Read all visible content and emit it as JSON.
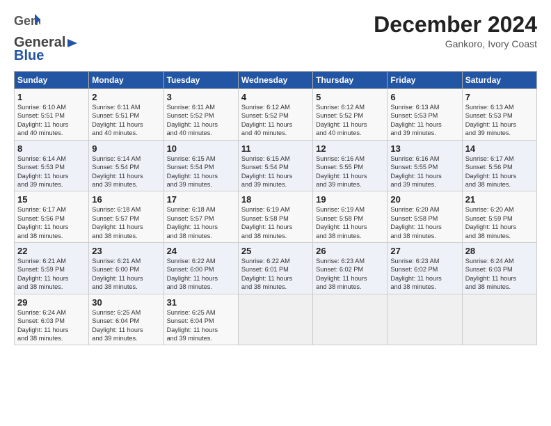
{
  "logo": {
    "part1": "General",
    "part2": "Blue"
  },
  "header": {
    "month": "December 2024",
    "location": "Gankoro, Ivory Coast"
  },
  "weekdays": [
    "Sunday",
    "Monday",
    "Tuesday",
    "Wednesday",
    "Thursday",
    "Friday",
    "Saturday"
  ],
  "weeks": [
    [
      {
        "day": "1",
        "info": "Sunrise: 6:10 AM\nSunset: 5:51 PM\nDaylight: 11 hours\nand 40 minutes."
      },
      {
        "day": "2",
        "info": "Sunrise: 6:11 AM\nSunset: 5:51 PM\nDaylight: 11 hours\nand 40 minutes."
      },
      {
        "day": "3",
        "info": "Sunrise: 6:11 AM\nSunset: 5:52 PM\nDaylight: 11 hours\nand 40 minutes."
      },
      {
        "day": "4",
        "info": "Sunrise: 6:12 AM\nSunset: 5:52 PM\nDaylight: 11 hours\nand 40 minutes."
      },
      {
        "day": "5",
        "info": "Sunrise: 6:12 AM\nSunset: 5:52 PM\nDaylight: 11 hours\nand 40 minutes."
      },
      {
        "day": "6",
        "info": "Sunrise: 6:13 AM\nSunset: 5:53 PM\nDaylight: 11 hours\nand 39 minutes."
      },
      {
        "day": "7",
        "info": "Sunrise: 6:13 AM\nSunset: 5:53 PM\nDaylight: 11 hours\nand 39 minutes."
      }
    ],
    [
      {
        "day": "8",
        "info": "Sunrise: 6:14 AM\nSunset: 5:53 PM\nDaylight: 11 hours\nand 39 minutes."
      },
      {
        "day": "9",
        "info": "Sunrise: 6:14 AM\nSunset: 5:54 PM\nDaylight: 11 hours\nand 39 minutes."
      },
      {
        "day": "10",
        "info": "Sunrise: 6:15 AM\nSunset: 5:54 PM\nDaylight: 11 hours\nand 39 minutes."
      },
      {
        "day": "11",
        "info": "Sunrise: 6:15 AM\nSunset: 5:54 PM\nDaylight: 11 hours\nand 39 minutes."
      },
      {
        "day": "12",
        "info": "Sunrise: 6:16 AM\nSunset: 5:55 PM\nDaylight: 11 hours\nand 39 minutes."
      },
      {
        "day": "13",
        "info": "Sunrise: 6:16 AM\nSunset: 5:55 PM\nDaylight: 11 hours\nand 39 minutes."
      },
      {
        "day": "14",
        "info": "Sunrise: 6:17 AM\nSunset: 5:56 PM\nDaylight: 11 hours\nand 38 minutes."
      }
    ],
    [
      {
        "day": "15",
        "info": "Sunrise: 6:17 AM\nSunset: 5:56 PM\nDaylight: 11 hours\nand 38 minutes."
      },
      {
        "day": "16",
        "info": "Sunrise: 6:18 AM\nSunset: 5:57 PM\nDaylight: 11 hours\nand 38 minutes."
      },
      {
        "day": "17",
        "info": "Sunrise: 6:18 AM\nSunset: 5:57 PM\nDaylight: 11 hours\nand 38 minutes."
      },
      {
        "day": "18",
        "info": "Sunrise: 6:19 AM\nSunset: 5:58 PM\nDaylight: 11 hours\nand 38 minutes."
      },
      {
        "day": "19",
        "info": "Sunrise: 6:19 AM\nSunset: 5:58 PM\nDaylight: 11 hours\nand 38 minutes."
      },
      {
        "day": "20",
        "info": "Sunrise: 6:20 AM\nSunset: 5:58 PM\nDaylight: 11 hours\nand 38 minutes."
      },
      {
        "day": "21",
        "info": "Sunrise: 6:20 AM\nSunset: 5:59 PM\nDaylight: 11 hours\nand 38 minutes."
      }
    ],
    [
      {
        "day": "22",
        "info": "Sunrise: 6:21 AM\nSunset: 5:59 PM\nDaylight: 11 hours\nand 38 minutes."
      },
      {
        "day": "23",
        "info": "Sunrise: 6:21 AM\nSunset: 6:00 PM\nDaylight: 11 hours\nand 38 minutes."
      },
      {
        "day": "24",
        "info": "Sunrise: 6:22 AM\nSunset: 6:00 PM\nDaylight: 11 hours\nand 38 minutes."
      },
      {
        "day": "25",
        "info": "Sunrise: 6:22 AM\nSunset: 6:01 PM\nDaylight: 11 hours\nand 38 minutes."
      },
      {
        "day": "26",
        "info": "Sunrise: 6:23 AM\nSunset: 6:02 PM\nDaylight: 11 hours\nand 38 minutes."
      },
      {
        "day": "27",
        "info": "Sunrise: 6:23 AM\nSunset: 6:02 PM\nDaylight: 11 hours\nand 38 minutes."
      },
      {
        "day": "28",
        "info": "Sunrise: 6:24 AM\nSunset: 6:03 PM\nDaylight: 11 hours\nand 38 minutes."
      }
    ],
    [
      {
        "day": "29",
        "info": "Sunrise: 6:24 AM\nSunset: 6:03 PM\nDaylight: 11 hours\nand 38 minutes."
      },
      {
        "day": "30",
        "info": "Sunrise: 6:25 AM\nSunset: 6:04 PM\nDaylight: 11 hours\nand 39 minutes."
      },
      {
        "day": "31",
        "info": "Sunrise: 6:25 AM\nSunset: 6:04 PM\nDaylight: 11 hours\nand 39 minutes."
      },
      {
        "day": "",
        "info": ""
      },
      {
        "day": "",
        "info": ""
      },
      {
        "day": "",
        "info": ""
      },
      {
        "day": "",
        "info": ""
      }
    ]
  ]
}
